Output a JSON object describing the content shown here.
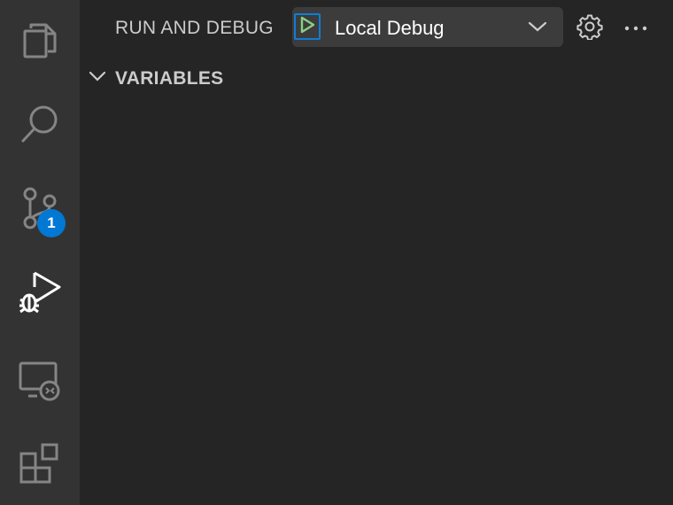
{
  "activity_bar": {
    "items": [
      {
        "name": "explorer",
        "icon": "files-icon"
      },
      {
        "name": "search",
        "icon": "search-icon"
      },
      {
        "name": "source-control",
        "icon": "source-control-icon",
        "badge": "1"
      },
      {
        "name": "run-and-debug",
        "icon": "debug-alt-icon",
        "active": true
      },
      {
        "name": "remote-explorer",
        "icon": "remote-explorer-icon"
      },
      {
        "name": "extensions",
        "icon": "extensions-icon"
      }
    ]
  },
  "header": {
    "title": "RUN AND DEBUG",
    "config_name": "Local Debug",
    "play_icon": "play-icon",
    "dropdown_icon": "chevron-down-icon",
    "settings_icon": "gear-icon",
    "more_icon": "ellipsis-icon"
  },
  "sections": {
    "variables": {
      "title": "VARIABLES",
      "expanded": true
    }
  },
  "colors": {
    "activity_bg": "#333333",
    "sidebar_bg": "#252526",
    "badge": "#0078d4",
    "play": "#89d185",
    "focus_border": "#0e7ed6"
  }
}
